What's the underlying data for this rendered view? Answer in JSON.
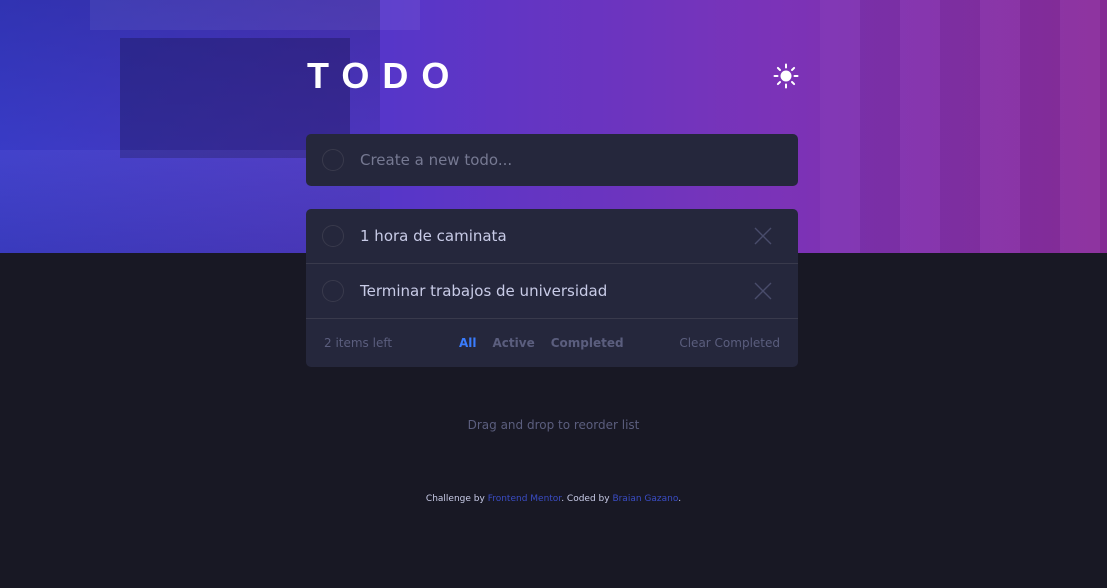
{
  "header": {
    "title": "TODO",
    "theme_icon": "sun-icon"
  },
  "new_todo": {
    "placeholder": "Create a new todo..."
  },
  "todos": [
    {
      "text": "1 hora de caminata",
      "completed": false
    },
    {
      "text": "Terminar trabajos de universidad",
      "completed": false
    }
  ],
  "footer": {
    "items_left": "2 items left",
    "filters": [
      "All",
      "Active",
      "Completed"
    ],
    "active_filter": "All",
    "clear": "Clear Completed"
  },
  "hint": "Drag and drop to reorder list",
  "attribution": {
    "prefix": "Challenge by ",
    "link1": "Frontend Mentor",
    "middle": ". Coded by ",
    "link2": "Braian Gazano",
    "suffix": "."
  },
  "colors": {
    "background": "#181824",
    "card": "#25273c",
    "accent": "#3a7cfd",
    "text": "#c8cbe7",
    "muted": "#5b5e7e"
  }
}
